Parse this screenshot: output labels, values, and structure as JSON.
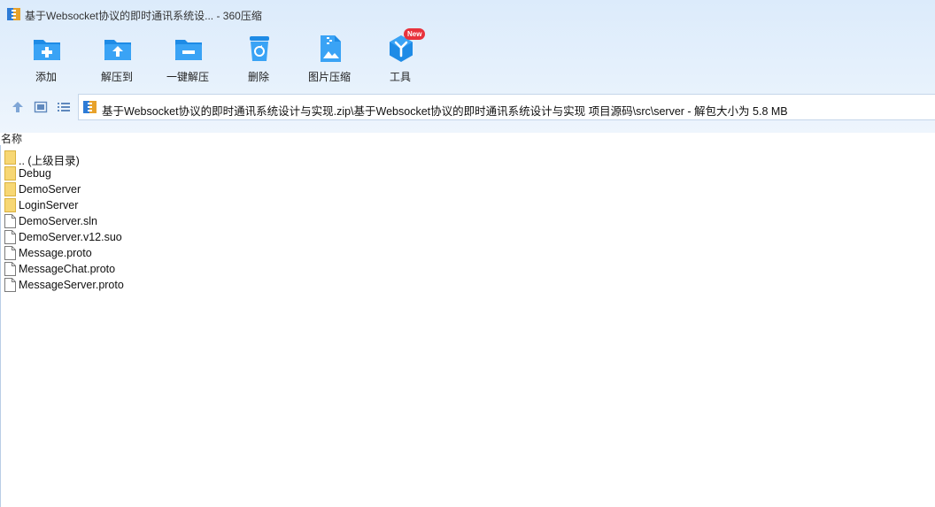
{
  "window": {
    "title": "基于Websocket协议的即时通讯系统设... - 360压缩"
  },
  "toolbar": {
    "items": [
      {
        "label": "添加",
        "icon": "add-folder-icon"
      },
      {
        "label": "解压到",
        "icon": "extract-to-icon"
      },
      {
        "label": "一键解压",
        "icon": "one-click-extract-icon"
      },
      {
        "label": "删除",
        "icon": "delete-bin-icon"
      },
      {
        "label": "图片压缩",
        "icon": "image-compress-icon"
      },
      {
        "label": "工具",
        "icon": "tools-icon",
        "badge": "New"
      }
    ]
  },
  "nav": {
    "path": "基于Websocket协议的即时通讯系统设计与实现.zip\\基于Websocket协议的即时通讯系统设计与实现 项目源码\\src\\server - 解包大小为 5.8 MB"
  },
  "list": {
    "column_name": "名称",
    "items": [
      {
        "name": ".. (上级目录)",
        "type": "folder"
      },
      {
        "name": "Debug",
        "type": "folder"
      },
      {
        "name": "DemoServer",
        "type": "folder"
      },
      {
        "name": "LoginServer",
        "type": "folder"
      },
      {
        "name": "DemoServer.sln",
        "type": "file"
      },
      {
        "name": "DemoServer.v12.suo",
        "type": "file"
      },
      {
        "name": "Message.proto",
        "type": "file"
      },
      {
        "name": "MessageChat.proto",
        "type": "file"
      },
      {
        "name": "MessageServer.proto",
        "type": "file"
      }
    ]
  },
  "colors": {
    "accent": "#1e8be6",
    "accent_light": "#3aa3f5",
    "header_bg": "#dcebfb",
    "folder": "#f7d774",
    "badge": "#e8323c"
  }
}
